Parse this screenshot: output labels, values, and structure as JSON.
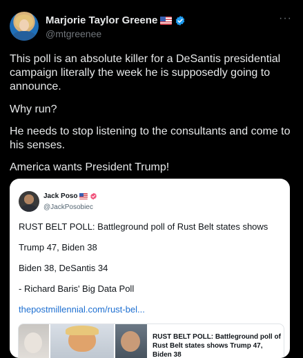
{
  "tweet": {
    "author": {
      "name": "Marjorie Taylor Greene",
      "handle": "@mtgreenee"
    },
    "more_icon": "more-horizontal-icon",
    "paragraphs": [
      "This poll is an absolute killer for a DeSantis presidential campaign literally the week he is supposedly going to announce.",
      "Why run?",
      "He needs to stop listening to the consultants and come to his senses.",
      "America wants President Trump!"
    ],
    "quoted": {
      "author": {
        "name": "Jack Poso",
        "handle": "@JackPosobiec"
      },
      "lines": [
        "RUST BELT POLL: Battleground poll of Rust Belt states shows",
        "Trump 47, Biden 38",
        "Biden 38, DeSantis 34",
        "- Richard Baris' Big Data Poll"
      ],
      "link": "thepostmillennial.com/rust-bel...",
      "card": {
        "title": "RUST BELT POLL: Battleground poll of Rust Belt states shows Trump 47, Biden 38"
      }
    }
  },
  "colors": {
    "background": "#000000",
    "text_primary": "#e7e9ea",
    "text_secondary": "#71767b",
    "verified_blue": "#1d9bf0",
    "verified_pink": "#f0517a",
    "link": "#1d6fd1"
  }
}
